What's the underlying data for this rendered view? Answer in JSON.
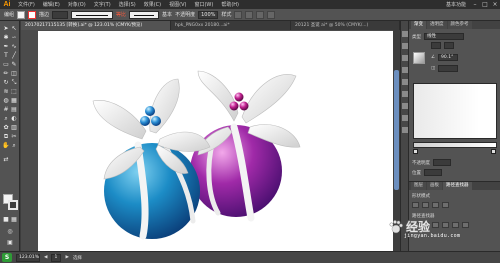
{
  "app": {
    "logo": "Ai",
    "menus": [
      "文件(F)",
      "编辑(E)",
      "对象(O)",
      "文字(T)",
      "选择(S)",
      "效果(C)",
      "视图(V)",
      "窗口(W)",
      "帮助(H)"
    ],
    "workspace": "基本功能",
    "window_buttons": [
      "–",
      "□",
      "×"
    ]
  },
  "control_bar": {
    "selection_label": "编组",
    "stroke_label": "描边",
    "uniform_label": "等比",
    "basic_label": "基本",
    "opacity_label": "不透明度",
    "opacity_value": "100%",
    "style_label": "样式"
  },
  "tabs": [
    {
      "label": "20170217115135 [转换].ai* @ 123.01% (CMYK/预览)",
      "active": true
    },
    {
      "label": "hpk_PNG0xx 20180...ai*",
      "active": false
    },
    {
      "label": "20121 圣诞 ai* @ 50% (CMYK/...)",
      "active": false
    }
  ],
  "panel": {
    "tabs": [
      "渐变",
      "透明度",
      "颜色参考"
    ],
    "type_label": "类型",
    "type_value": "线性",
    "angle_value": "90.1°",
    "opacity_label": "不透明度",
    "location_label": "位置",
    "layers_tabs": [
      "图层",
      "画板",
      "路径查找器"
    ],
    "shape_modes_label": "形状模式",
    "pathfinder_label": "路径查找器"
  },
  "status": {
    "zoom": "123.01%",
    "artboard": "1",
    "selection": "选择"
  },
  "watermark": {
    "text": "经验",
    "sub": "jingyan.baidu.com"
  },
  "colors": {
    "accent": "#ff9a00",
    "blue_ornament": "#1c8cc6",
    "purple_ornament": "#a02aa8",
    "ribbon": "#f2f2f2"
  }
}
